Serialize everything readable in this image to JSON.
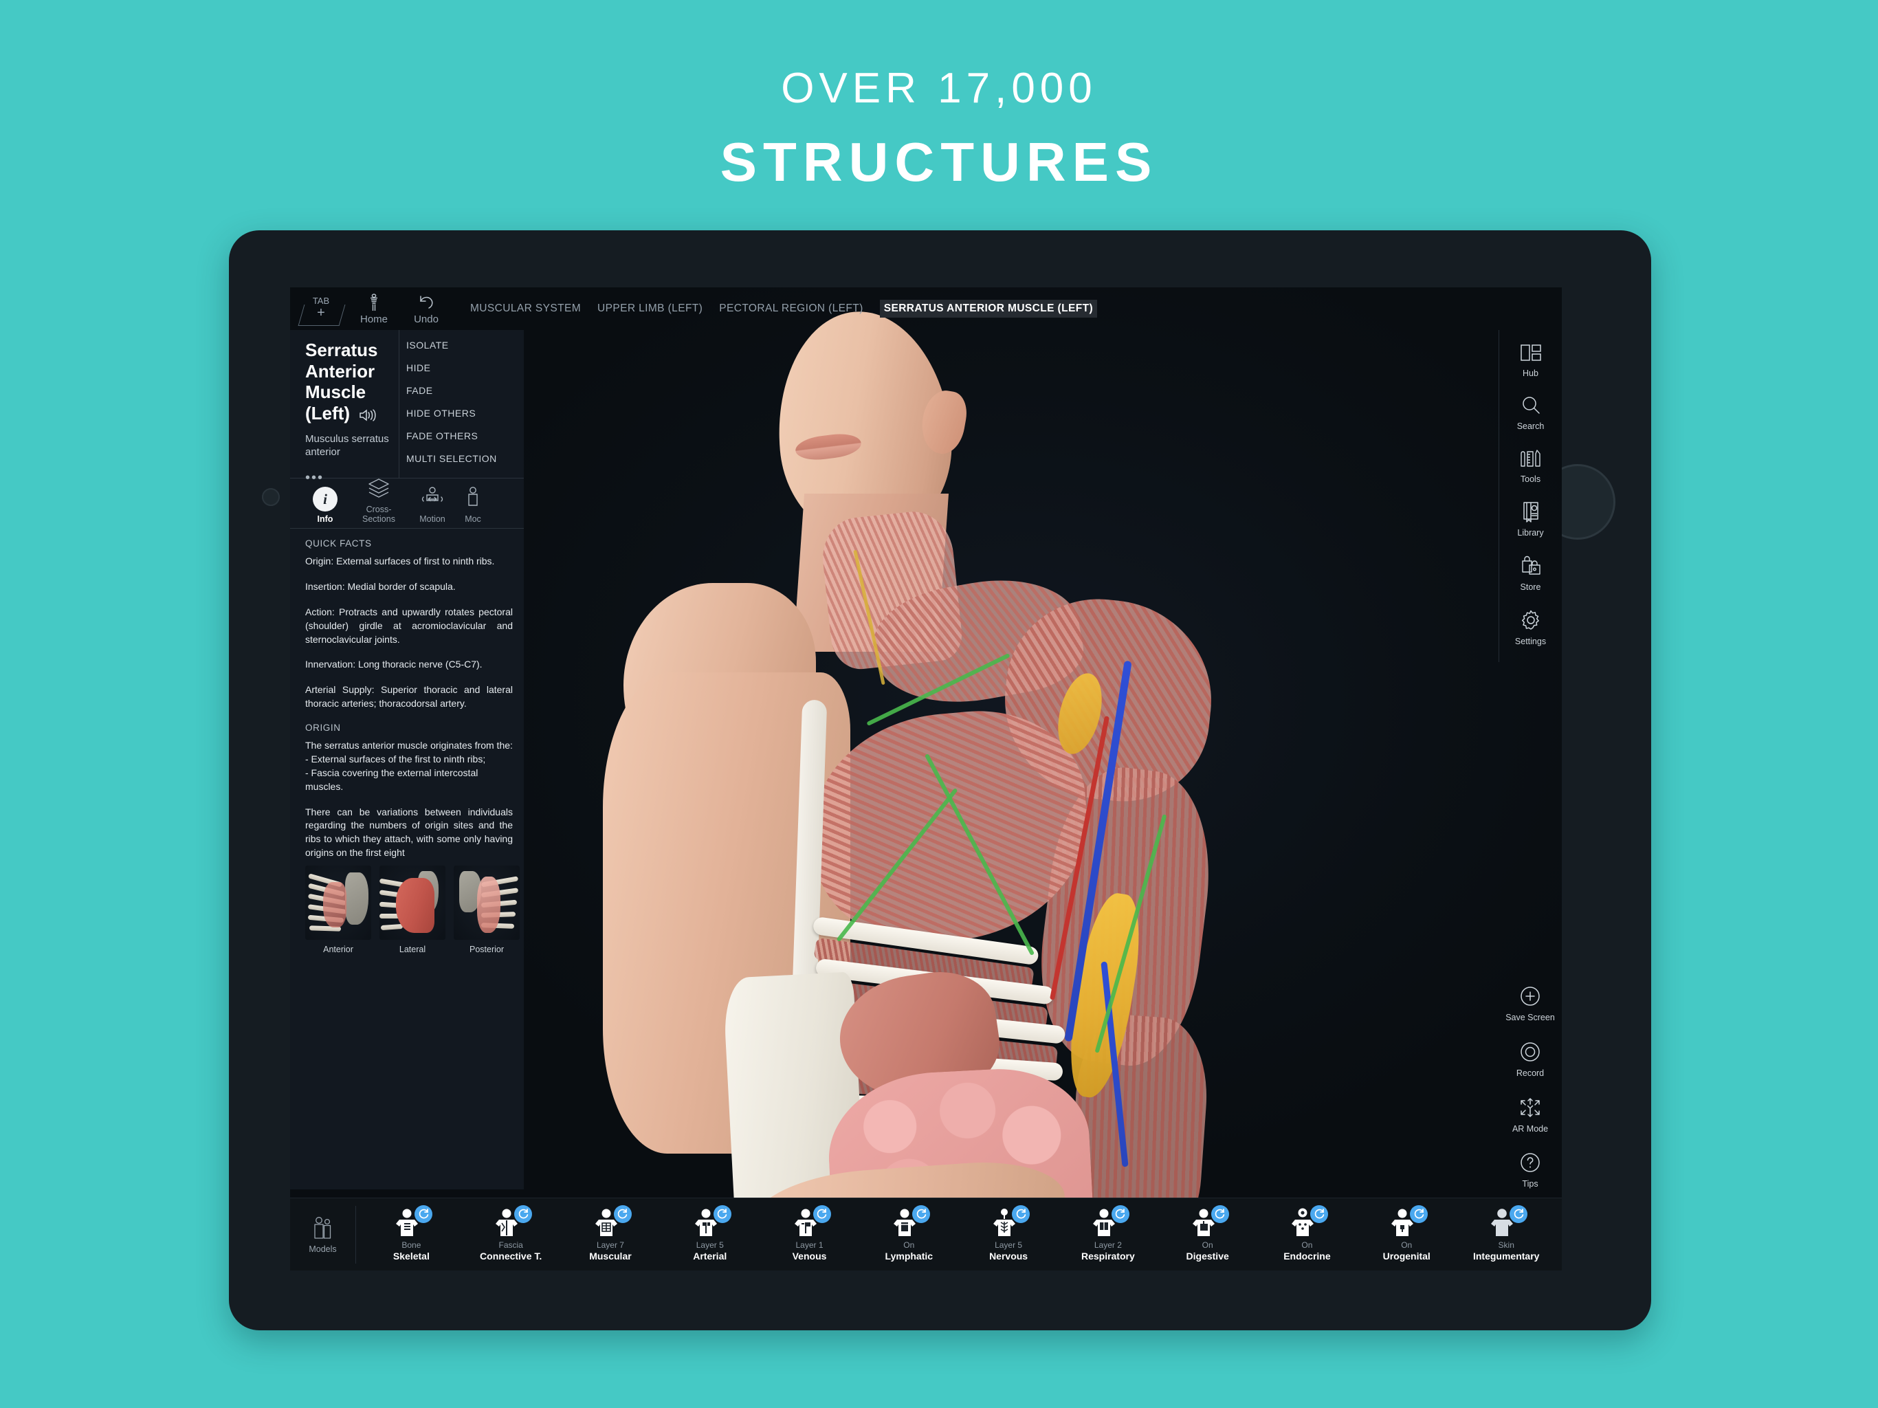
{
  "headline": {
    "top": "OVER 17,000",
    "main": "STRUCTURES"
  },
  "colors": {
    "background_teal": "#45c9c5",
    "screen_dark": "#0d1117",
    "panel_dark": "#121820",
    "badge_blue": "#4aa8ef",
    "accent_white": "#ffffff"
  },
  "topbar": {
    "tab_label": "TAB",
    "tab_plus": "+",
    "home_label": "Home",
    "undo_label": "Undo",
    "breadcrumbs": [
      {
        "label": "MUSCULAR SYSTEM",
        "active": false
      },
      {
        "label": "UPPER LIMB (LEFT)",
        "active": false
      },
      {
        "label": "PECTORAL REGION (LEFT)",
        "active": false
      },
      {
        "label": "SERRATUS ANTERIOR MUSCLE (LEFT)",
        "active": true
      }
    ]
  },
  "viewport": {
    "overlay_label": "SERRATUS ANTERIOR MUSCLE (LEFT)"
  },
  "left_panel": {
    "title": "Serratus Anterior Muscle (Left)",
    "latin_name": "Musculus serratus anterior",
    "more_dots": "•••",
    "actions": [
      "ISOLATE",
      "HIDE",
      "FADE",
      "HIDE OTHERS",
      "FADE OTHERS",
      "MULTI SELECTION"
    ],
    "tabs": [
      {
        "label": "Info",
        "icon": "info-icon",
        "active": true
      },
      {
        "label": "Cross-Sections",
        "icon": "layers-icon",
        "active": false
      },
      {
        "label": "Motion",
        "icon": "motion-icon",
        "active": false
      },
      {
        "label": "Moc",
        "icon": "model-icon",
        "active": false
      }
    ],
    "quick_facts_label": "QUICK FACTS",
    "quick_facts": [
      "Origin: External surfaces of first to ninth ribs.",
      "Insertion: Medial border of scapula.",
      "Action: Protracts and upwardly rotates pectoral (shoulder) girdle at acromioclavicular and sternoclavicular joints.",
      "Innervation: Long thoracic nerve (C5-C7).",
      "Arterial Supply: Superior thoracic and lateral thoracic arteries; thoracodorsal artery."
    ],
    "origin_label": "ORIGIN",
    "origin_paragraphs": [
      "The serratus anterior muscle originates from the:\n- External surfaces of the first to ninth ribs;\n- Fascia covering the external intercostal muscles.",
      "There can be variations between individuals regarding the numbers of origin sites and the ribs to which they attach, with some only having origins on the first eight"
    ],
    "thumbnails": [
      {
        "caption": "Anterior"
      },
      {
        "caption": "Lateral"
      },
      {
        "caption": "Posterior"
      }
    ]
  },
  "right_rail": {
    "top_items": [
      {
        "label": "Hub",
        "icon": "hub-icon"
      },
      {
        "label": "Search",
        "icon": "search-icon"
      },
      {
        "label": "Tools",
        "icon": "tools-icon"
      },
      {
        "label": "Library",
        "icon": "library-icon"
      },
      {
        "label": "Store",
        "icon": "store-icon"
      },
      {
        "label": "Settings",
        "icon": "gear-icon"
      }
    ],
    "bottom_items": [
      {
        "label": "Save Screen",
        "icon": "plus-circle-icon"
      },
      {
        "label": "Record",
        "icon": "record-icon"
      },
      {
        "label": "AR Mode",
        "icon": "ar-mode-icon"
      },
      {
        "label": "Tips",
        "icon": "question-circle-icon"
      }
    ]
  },
  "bottom_bar": {
    "models_label": "Models",
    "tips_label": "Tips",
    "systems": [
      {
        "name": "Skeletal",
        "state": "Bone",
        "icon": "skeletal-icon"
      },
      {
        "name": "Connective T.",
        "state": "Fascia",
        "icon": "connective-icon"
      },
      {
        "name": "Muscular",
        "state": "Layer 7",
        "icon": "muscular-icon"
      },
      {
        "name": "Arterial",
        "state": "Layer 5",
        "icon": "arterial-icon"
      },
      {
        "name": "Venous",
        "state": "Layer 1",
        "icon": "venous-icon"
      },
      {
        "name": "Lymphatic",
        "state": "On",
        "icon": "lymphatic-icon"
      },
      {
        "name": "Nervous",
        "state": "Layer 5",
        "icon": "nervous-icon"
      },
      {
        "name": "Respiratory",
        "state": "Layer 2",
        "icon": "respiratory-icon"
      },
      {
        "name": "Digestive",
        "state": "On",
        "icon": "digestive-icon"
      },
      {
        "name": "Endocrine",
        "state": "On",
        "icon": "endocrine-icon"
      },
      {
        "name": "Urogenital",
        "state": "On",
        "icon": "urogenital-icon"
      },
      {
        "name": "Integumentary",
        "state": "Skin",
        "icon": "integumentary-icon"
      }
    ]
  }
}
